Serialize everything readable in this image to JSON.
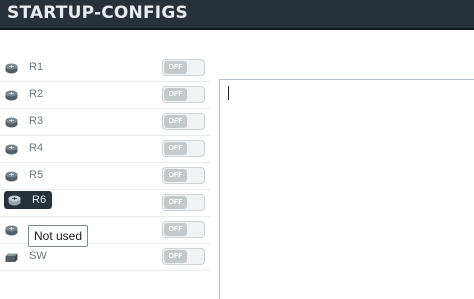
{
  "header": {
    "title": "STARTUP-CONFIGS"
  },
  "devices": [
    {
      "name": "R1",
      "icon": "router-icon",
      "toggle_label": "OFF",
      "enabled": false
    },
    {
      "name": "R2",
      "icon": "router-icon",
      "toggle_label": "OFF",
      "enabled": false
    },
    {
      "name": "R3",
      "icon": "router-icon",
      "toggle_label": "OFF",
      "enabled": false
    },
    {
      "name": "R4",
      "icon": "router-icon",
      "toggle_label": "OFF",
      "enabled": false
    },
    {
      "name": "R5",
      "icon": "router-icon",
      "toggle_label": "OFF",
      "enabled": false
    },
    {
      "name": "R6",
      "icon": "router-icon",
      "toggle_label": "OFF",
      "enabled": false,
      "selected": true
    },
    {
      "name": "",
      "icon": "router-icon",
      "toggle_label": "OFF",
      "enabled": false
    },
    {
      "name": "SW",
      "icon": "switch-icon",
      "toggle_label": "OFF",
      "enabled": false
    }
  ],
  "tooltip": {
    "text": "Not used"
  },
  "editor": {
    "value": ""
  },
  "colors": {
    "header_bg": "#263238",
    "toggle_off": "#c4c9cc",
    "text_muted": "#6b7780"
  }
}
